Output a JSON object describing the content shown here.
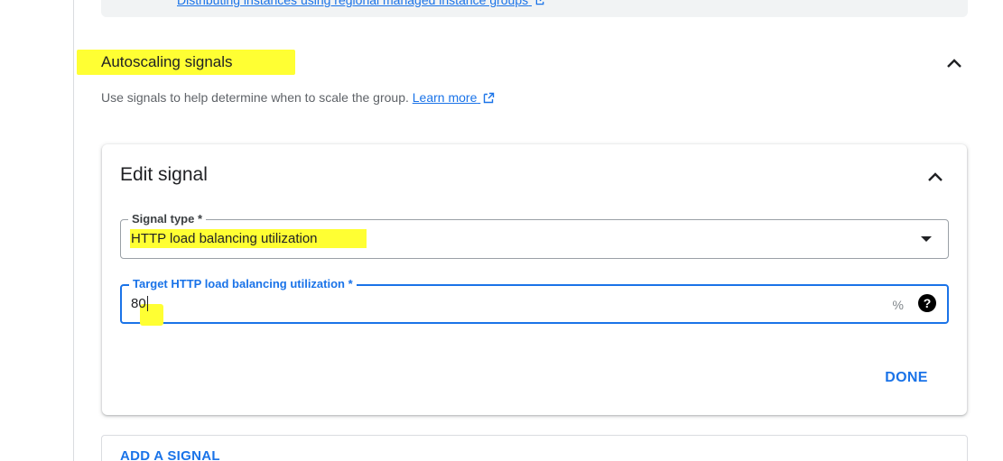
{
  "top_card": {
    "link_text": "Distributing instances using regional managed instance groups"
  },
  "section": {
    "title": "Autoscaling signals",
    "description": "Use signals to help determine when to scale the group.",
    "learn_more": "Learn more"
  },
  "edit_signal": {
    "title": "Edit signal",
    "signal_type": {
      "label": "Signal type *",
      "value": "HTTP load balancing utilization"
    },
    "target": {
      "label": "Target HTTP load balancing utilization *",
      "value": "80",
      "suffix": "%",
      "help_glyph": "?"
    },
    "done_label": "DONE"
  },
  "add_signal_label": "ADD A SIGNAL",
  "colors": {
    "accent": "#1a73e8",
    "highlight": "#ffff33",
    "text": "#202124",
    "muted": "#5f6368"
  },
  "icons": {
    "collapse": "chevron-up-icon",
    "external": "external-link-icon",
    "dropdown": "dropdown-arrow-icon",
    "help": "help-icon"
  }
}
